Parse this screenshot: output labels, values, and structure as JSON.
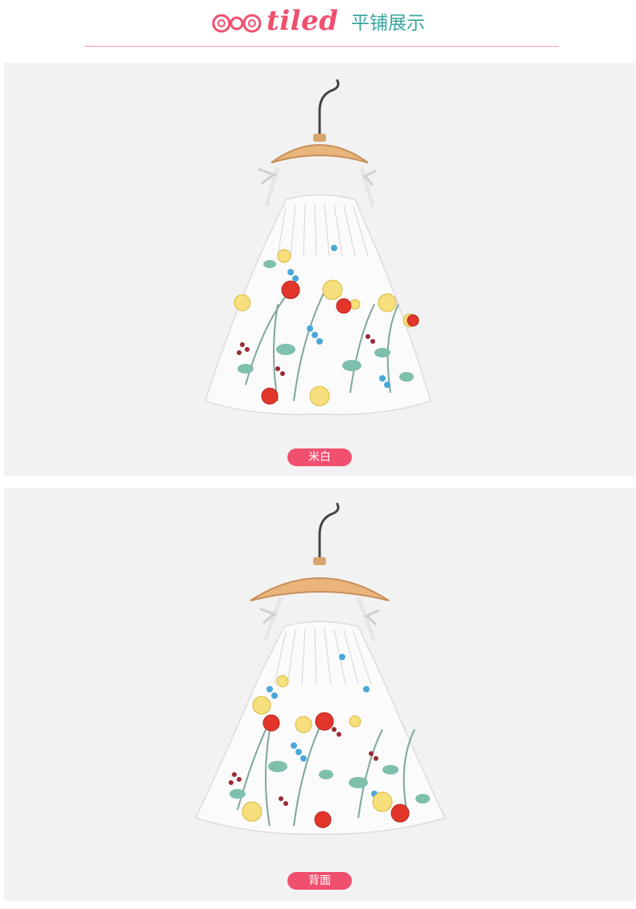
{
  "header": {
    "brand": "tiled",
    "subtitle": "平铺展示",
    "logo_icon": "bow-logo-icon",
    "accent_color": "#f0506e",
    "subtitle_color": "#3aa6a0"
  },
  "panels": [
    {
      "label": "米白",
      "image": "floral-dress-front-on-hanger"
    },
    {
      "label": "背面",
      "image": "floral-dress-back-on-hanger"
    }
  ]
}
